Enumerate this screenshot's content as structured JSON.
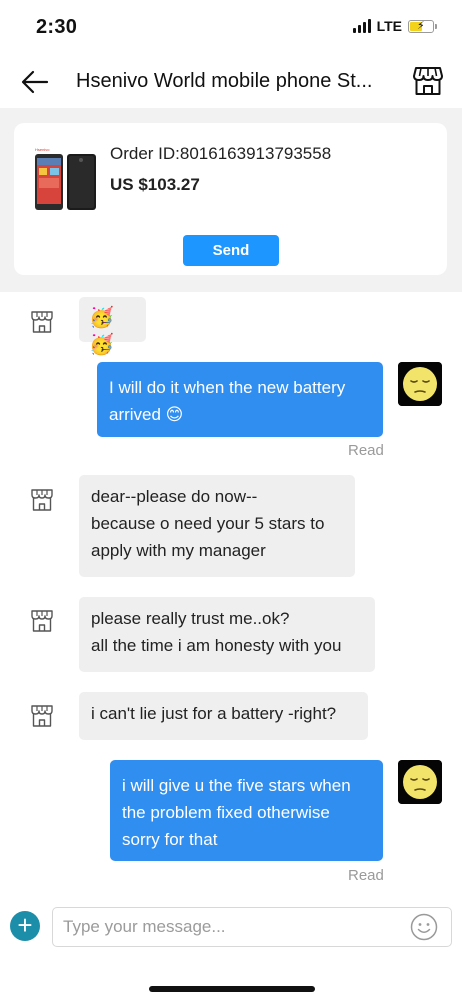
{
  "status_bar": {
    "time": "2:30",
    "network": "LTE"
  },
  "header": {
    "title": "Hsenivo World mobile phone St..."
  },
  "order": {
    "id_text": "Order ID:8016163913793558",
    "price": "US $103.27",
    "send_label": "Send"
  },
  "messages": [
    {
      "from": "store",
      "text": "🥳🥳"
    },
    {
      "from": "me",
      "lines": [
        "I will do it when the new battery",
        "arrived 😊"
      ],
      "status": "Read"
    },
    {
      "from": "store",
      "lines": [
        "dear--please do now--",
        "because o need your 5 stars to",
        "apply with my manager"
      ]
    },
    {
      "from": "store",
      "lines": [
        "please really trust me..ok?",
        "all the time i am honesty with you"
      ]
    },
    {
      "from": "store",
      "lines": [
        "i can't lie just for a battery -right?"
      ]
    },
    {
      "from": "me",
      "lines": [
        "i will give u the five stars when",
        "the problem fixed otherwise",
        "sorry for that"
      ],
      "status": "Read"
    }
  ],
  "composer": {
    "placeholder": "Type your message..."
  },
  "colors": {
    "accent": "#1e96ff",
    "outgoing_bubble": "#2f8ef0",
    "incoming_bubble": "#efefef",
    "add_button": "#1d8ea9"
  },
  "icons": [
    "back-arrow-icon",
    "store-icon",
    "plus-icon",
    "smiley-icon",
    "signal-icon",
    "battery-charging-icon"
  ]
}
